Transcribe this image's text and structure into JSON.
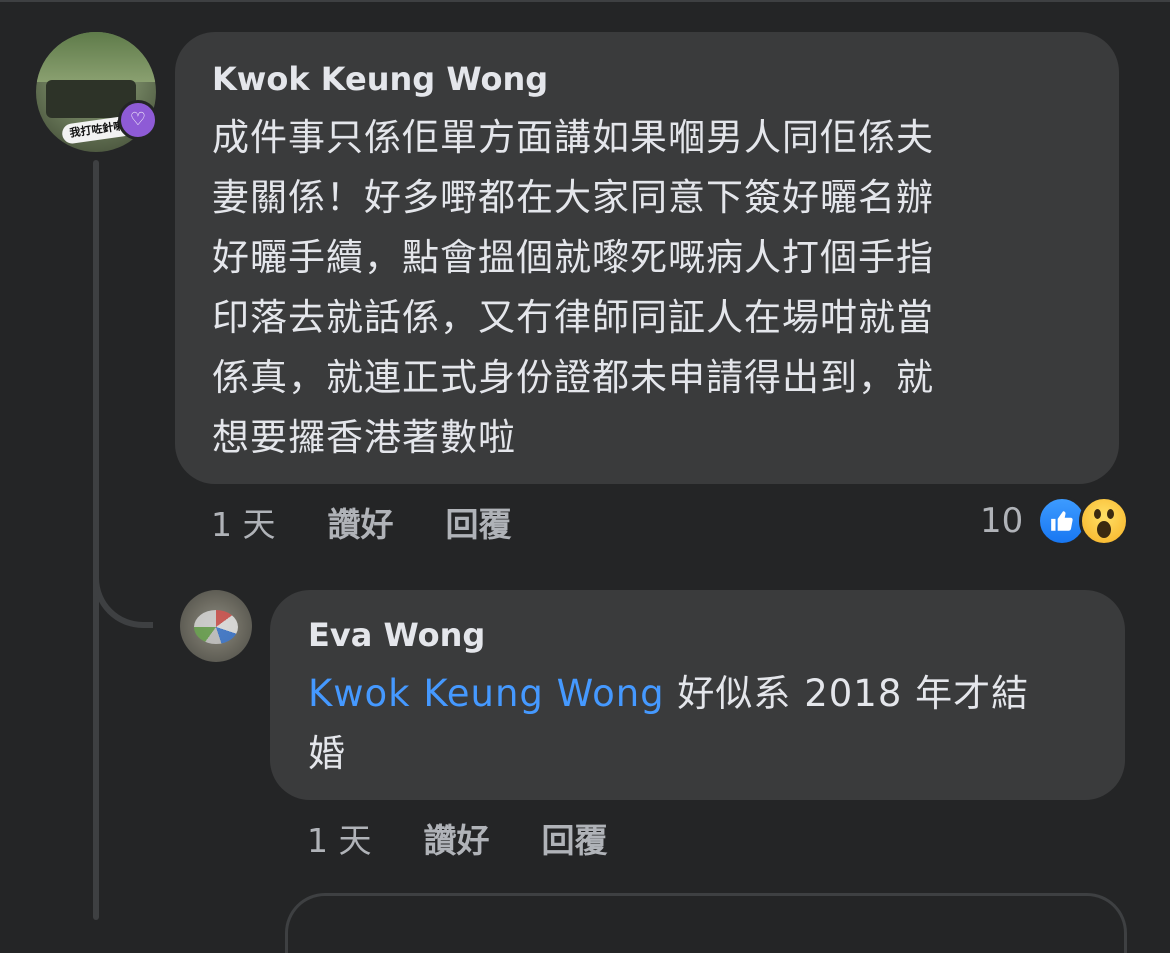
{
  "comments": [
    {
      "author": "Kwok Keung Wong",
      "avatar_sticker": "我打咗針喇",
      "lines": [
        "成件事只係佢單方面講如果嗰男人同佢係夫",
        "妻關係！好多嘢都在大家同意下簽好曬名辦",
        "好曬手續，點會搵個就嚟死嘅病人打個手指",
        "印落去就話係，又冇律師同証人在場咁就當",
        "係真，就連正式身份證都未申請得出到，就",
        "想要攞香港著數啦"
      ],
      "time": "1 天",
      "like_label": "讚好",
      "reply_label": "回覆",
      "reaction_count": "10",
      "reaction_icons": [
        "like-icon",
        "wow-icon"
      ],
      "badge_icon": "heart-badge-icon"
    },
    {
      "author": "Eva Wong",
      "mention": "Kwok Keung Wong",
      "text_line1": " 好似系 2018 年才結",
      "text_line2": "婚",
      "time": "1 天",
      "like_label": "讚好",
      "reply_label": "回覆"
    }
  ],
  "colors": {
    "background": "#242526",
    "bubble": "#3a3b3c",
    "text": "#e4e6eb",
    "secondary_text": "#b0b3b8",
    "mention": "#4599ff",
    "like_blue": "#1877f2"
  }
}
